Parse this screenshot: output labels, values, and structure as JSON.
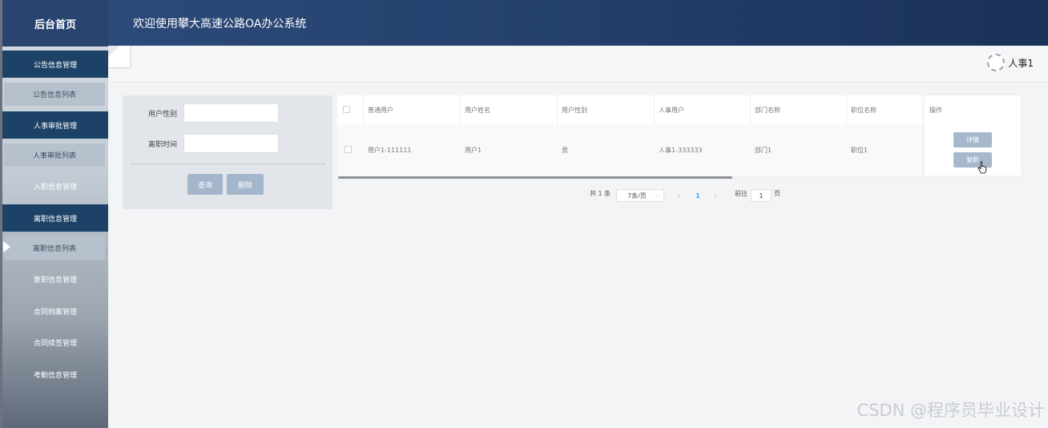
{
  "sidebar": {
    "home": "后台首页",
    "items": [
      {
        "label": "公告信息管理",
        "type": "group"
      },
      {
        "label": "公告信息列表",
        "type": "sub"
      },
      {
        "label": "人事审批管理",
        "type": "group"
      },
      {
        "label": "人事审批列表",
        "type": "sub"
      },
      {
        "label": "入职信息管理",
        "type": "plain"
      },
      {
        "label": "离职信息管理",
        "type": "group"
      },
      {
        "label": "离职信息列表",
        "type": "sub",
        "active": true
      },
      {
        "label": "复职信息管理",
        "type": "plain"
      },
      {
        "label": "合同档案管理",
        "type": "plain"
      },
      {
        "label": "合同续签管理",
        "type": "plain"
      },
      {
        "label": "考勤信息管理",
        "type": "plain"
      }
    ]
  },
  "header": {
    "title": "欢迎使用攀大高速公路OA办公系统"
  },
  "topbar": {
    "user_name": "人事1"
  },
  "search": {
    "fields": [
      {
        "label": "用户性别",
        "value": ""
      },
      {
        "label": "离职时间",
        "value": ""
      }
    ],
    "query_label": "查询",
    "delete_label": "删除"
  },
  "table": {
    "columns": [
      "普通用户",
      "用户姓名",
      "用户性别",
      "人事用户",
      "部门名称",
      "职位名称",
      "操作"
    ],
    "rows": [
      {
        "user": "用户1-111111",
        "name": "用户1",
        "gender": "男",
        "hr": "人事1-333333",
        "dept": "部门1",
        "position": "职位1"
      }
    ],
    "actions": {
      "detail": "详情",
      "reinstate": "复职"
    }
  },
  "pagination": {
    "total": "共 1 条",
    "page_size": "7条/页",
    "current_page": "1",
    "goto_label": "前往",
    "goto_value": "1",
    "page_suffix": "页"
  },
  "watermark": "CSDN @程序员毕业设计"
}
